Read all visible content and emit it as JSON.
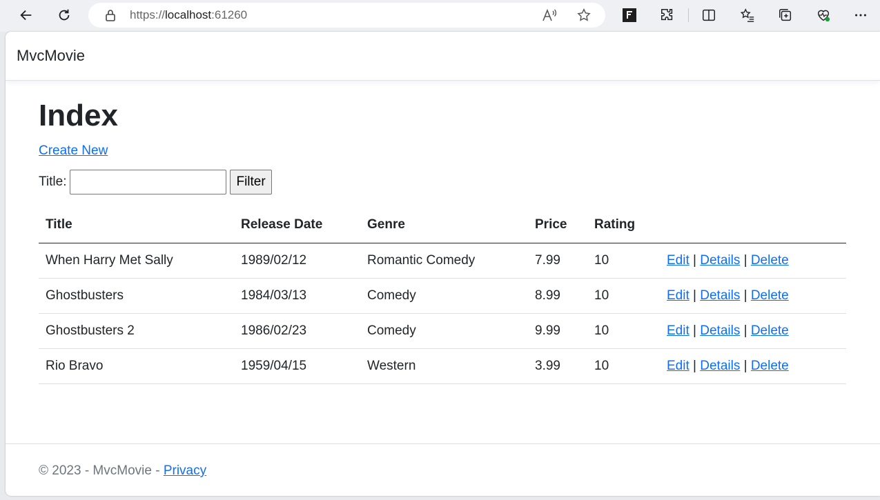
{
  "browser": {
    "url_scheme": "https://",
    "url_host": "localhost",
    "url_port": ":61260"
  },
  "app": {
    "brand": "MvcMovie"
  },
  "page": {
    "title": "Index",
    "create_link": "Create New",
    "filter_label": "Title:",
    "filter_value": "",
    "filter_button": "Filter"
  },
  "table": {
    "headers": [
      "Title",
      "Release Date",
      "Genre",
      "Price",
      "Rating"
    ],
    "rows": [
      {
        "title": "When Harry Met Sally",
        "release_date": "1989/02/12",
        "genre": "Romantic Comedy",
        "price": "7.99",
        "rating": "10"
      },
      {
        "title": "Ghostbusters",
        "release_date": "1984/03/13",
        "genre": "Comedy",
        "price": "8.99",
        "rating": "10"
      },
      {
        "title": "Ghostbusters 2",
        "release_date": "1986/02/23",
        "genre": "Comedy",
        "price": "9.99",
        "rating": "10"
      },
      {
        "title": "Rio Bravo",
        "release_date": "1959/04/15",
        "genre": "Western",
        "price": "3.99",
        "rating": "10"
      }
    ],
    "actions": {
      "edit": "Edit",
      "details": "Details",
      "delete": "Delete",
      "separator": "|"
    }
  },
  "footer": {
    "text": "© 2023 - MvcMovie - ",
    "privacy": "Privacy"
  },
  "colors": {
    "link": "#0d6efd",
    "text": "#212529",
    "muted": "#6c757d"
  }
}
